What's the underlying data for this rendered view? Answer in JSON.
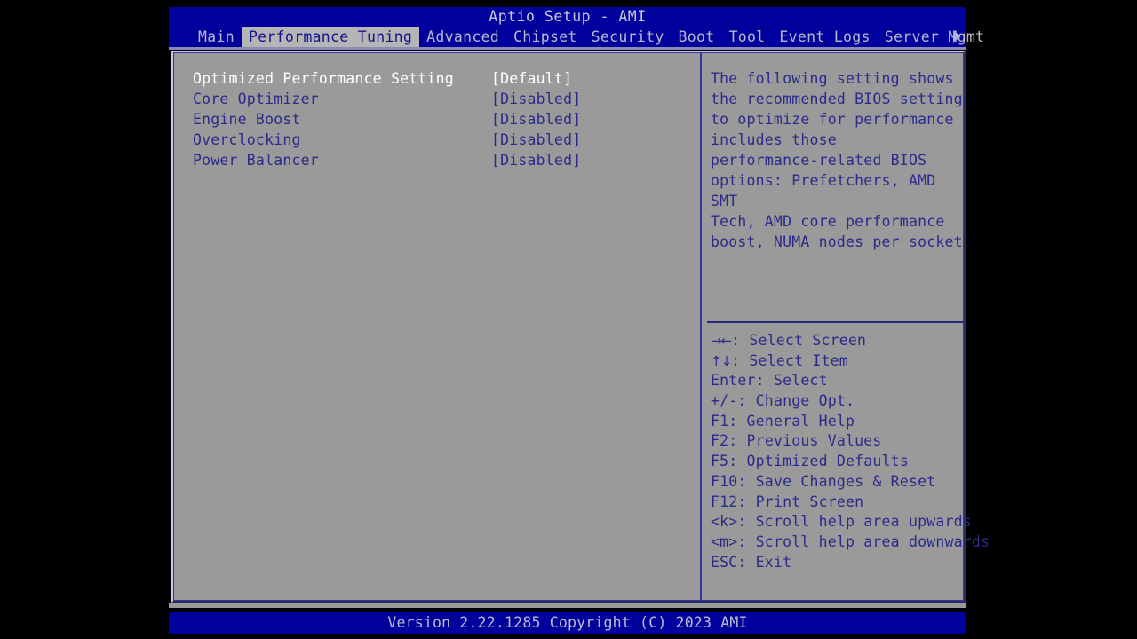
{
  "window": {
    "title": "Aptio Setup - AMI"
  },
  "menubar": {
    "tabs": [
      {
        "label": "Main",
        "selected": false
      },
      {
        "label": "Performance Tuning",
        "selected": true
      },
      {
        "label": "Advanced",
        "selected": false
      },
      {
        "label": "Chipset",
        "selected": false
      },
      {
        "label": "Security",
        "selected": false
      },
      {
        "label": "Boot",
        "selected": false
      },
      {
        "label": "Tool",
        "selected": false
      },
      {
        "label": "Event Logs",
        "selected": false
      },
      {
        "label": "Server Mgmt",
        "selected": false
      }
    ],
    "more_arrow_icon": "triangle-right-icon"
  },
  "settings": {
    "rows": [
      {
        "label": "Optimized Performance Setting",
        "value": "[Default]",
        "selected": true
      },
      {
        "label": "Core Optimizer",
        "value": "[Disabled]",
        "selected": false
      },
      {
        "label": "Engine Boost",
        "value": "[Disabled]",
        "selected": false
      },
      {
        "label": "Overclocking",
        "value": "[Disabled]",
        "selected": false
      },
      {
        "label": "Power Balancer",
        "value": "[Disabled]",
        "selected": false
      }
    ]
  },
  "help": {
    "text": "The following setting shows\nthe recommended BIOS setting\nto optimize for performance\nincludes those\nperformance-related BIOS\noptions: Prefetchers, AMD SMT\nTech, AMD core performance\nboost, NUMA nodes per socket",
    "shortcuts": [
      {
        "keys": "→←",
        "keys_is_glyph": true,
        "text": ": Select Screen"
      },
      {
        "keys": "↑↓",
        "keys_is_glyph": true,
        "text": ": Select Item"
      },
      {
        "keys": "Enter",
        "keys_is_glyph": false,
        "text": ": Select"
      },
      {
        "keys": "+/-",
        "keys_is_glyph": false,
        "text": ": Change Opt."
      },
      {
        "keys": "F1",
        "keys_is_glyph": false,
        "text": ": General Help"
      },
      {
        "keys": "F2",
        "keys_is_glyph": false,
        "text": ": Previous Values"
      },
      {
        "keys": "F5",
        "keys_is_glyph": false,
        "text": ": Optimized Defaults"
      },
      {
        "keys": "F10",
        "keys_is_glyph": false,
        "text": ": Save Changes & Reset"
      },
      {
        "keys": "F12",
        "keys_is_glyph": false,
        "text": ": Print Screen"
      },
      {
        "keys": "<k>",
        "keys_is_glyph": false,
        "text": ": Scroll help area upwards"
      },
      {
        "keys": "<m>",
        "keys_is_glyph": false,
        "text": ": Scroll help area downwards"
      },
      {
        "keys": "ESC",
        "keys_is_glyph": false,
        "text": ": Exit"
      }
    ]
  },
  "footer": {
    "version_text": "Version 2.22.1285 Copyright (C) 2023 AMI"
  },
  "colors": {
    "header_blue": "#00009c",
    "panel_gray": "#9a9a9a",
    "text_blue": "#2a2a8c",
    "selected_text": "#ffffff",
    "tab_selected_bg": "#b5b5b5",
    "border_blue": "#3535a0"
  }
}
